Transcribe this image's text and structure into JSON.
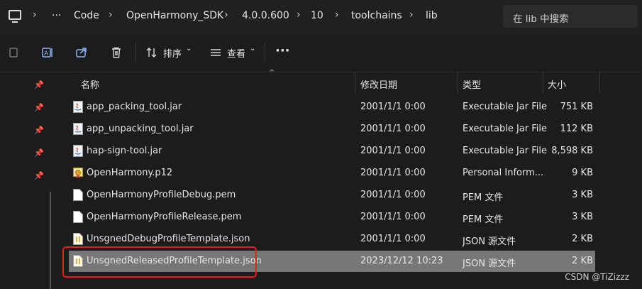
{
  "address_bar": {
    "crumbs": [
      "Code",
      "OpenHarmony_SDK",
      "4.0.0.600",
      "10",
      "toolchains",
      "lib"
    ],
    "ellipsis": "···",
    "search_placeholder": "在 lib 中搜索"
  },
  "toolbar": {
    "sort_label": "排序",
    "view_label": "查看",
    "more": "···"
  },
  "columns": {
    "name": "名称",
    "date": "修改日期",
    "type": "类型",
    "size": "大小"
  },
  "files": [
    {
      "name": "app_packing_tool.jar",
      "date": "2001/1/1 0:00",
      "type": "Executable Jar File",
      "size": "751 KB",
      "icon": "jar-icon",
      "selected": false
    },
    {
      "name": "app_unpacking_tool.jar",
      "date": "2001/1/1 0:00",
      "type": "Executable Jar File",
      "size": "112 KB",
      "icon": "jar-icon",
      "selected": false
    },
    {
      "name": "hap-sign-tool.jar",
      "date": "2001/1/1 0:00",
      "type": "Executable Jar File",
      "size": "8,598 KB",
      "icon": "jar-icon",
      "selected": false
    },
    {
      "name": "OpenHarmony.p12",
      "date": "2001/1/1 0:00",
      "type": "Personal Inform...",
      "size": "9 KB",
      "icon": "certificate-icon",
      "selected": false
    },
    {
      "name": "OpenHarmonyProfileDebug.pem",
      "date": "2001/1/1 0:00",
      "type": "PEM 文件",
      "size": "3 KB",
      "icon": "file-icon",
      "selected": false
    },
    {
      "name": "OpenHarmonyProfileRelease.pem",
      "date": "2001/1/1 0:00",
      "type": "PEM 文件",
      "size": "3 KB",
      "icon": "file-icon",
      "selected": false
    },
    {
      "name": "UnsgnedDebugProfileTemplate.json",
      "date": "2001/1/1 0:00",
      "type": "JSON 源文件",
      "size": "2 KB",
      "icon": "json-file-icon",
      "selected": false
    },
    {
      "name": "UnsgnedReleasedProfileTemplate.json",
      "date": "2023/12/12 10:23",
      "type": "JSON 源文件",
      "size": "2 KB",
      "icon": "json-file-icon",
      "selected": true
    }
  ],
  "watermark": "CSDN @TiZizzz",
  "colors": {
    "selection": "#777777",
    "highlight_box": "#e02020",
    "background": "#1c1c1c"
  }
}
